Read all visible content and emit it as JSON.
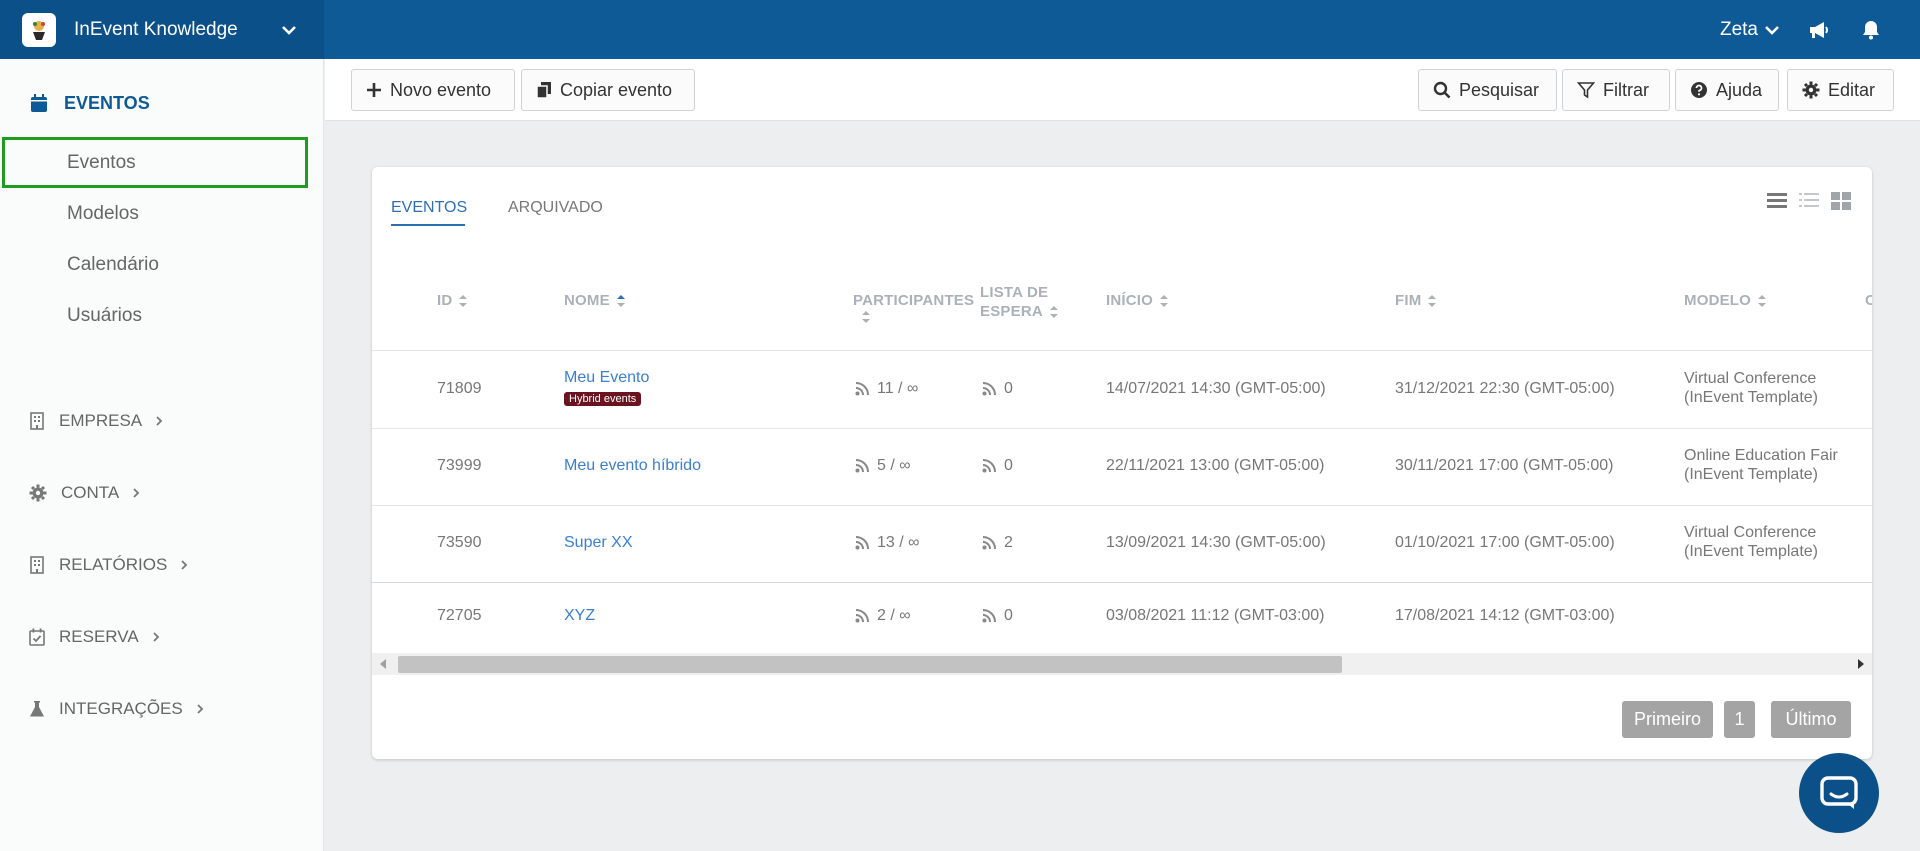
{
  "app": {
    "title": "InEvent Knowledge",
    "user": "Zeta"
  },
  "sidebar": {
    "section_title": "EVENTOS",
    "items": [
      {
        "label": "Eventos",
        "active": true
      },
      {
        "label": "Modelos"
      },
      {
        "label": "Calendário"
      },
      {
        "label": "Usuários"
      }
    ],
    "sections": [
      {
        "label": "EMPRESA",
        "icon": "building-icon"
      },
      {
        "label": "CONTA",
        "icon": "gear-icon"
      },
      {
        "label": "RELATÓRIOS",
        "icon": "building-icon"
      },
      {
        "label": "RESERVA",
        "icon": "calendar-check-icon"
      },
      {
        "label": "INTEGRAÇÕES",
        "icon": "flask-icon"
      }
    ]
  },
  "toolbar": {
    "new_event": "Novo evento",
    "copy_event": "Copiar evento",
    "search": "Pesquisar",
    "filter": "Filtrar",
    "help": "Ajuda",
    "edit": "Editar"
  },
  "tabs": [
    {
      "label": "EVENTOS",
      "active": true
    },
    {
      "label": "ARQUIVADO"
    }
  ],
  "table": {
    "columns": {
      "id": "ID",
      "name": "NOME",
      "participants": "PARTICIPANTES",
      "waitlist_1": "LISTA DE",
      "waitlist_2": "ESPERA",
      "start": "INÍCIO",
      "end": "FIM",
      "model": "MODELO",
      "cut": "C"
    },
    "rows": [
      {
        "id": "71809",
        "name": "Meu Evento",
        "badge": "Hybrid events",
        "participants": "11 / ∞",
        "waitlist": "0",
        "start": "14/07/2021 14:30 (GMT-05:00)",
        "end": "31/12/2021 22:30 (GMT-05:00)",
        "model_1": "Virtual Conference",
        "model_2": "(InEvent Template)"
      },
      {
        "id": "73999",
        "name": "Meu evento híbrido",
        "participants": "5 / ∞",
        "waitlist": "0",
        "start": "22/11/2021 13:00 (GMT-05:00)",
        "end": "30/11/2021 17:00 (GMT-05:00)",
        "model_1": "Online Education Fair",
        "model_2": "(InEvent Template)"
      },
      {
        "id": "73590",
        "name": "Super XX",
        "participants": "13 / ∞",
        "waitlist": "2",
        "start": "13/09/2021 14:30 (GMT-05:00)",
        "end": "01/10/2021 17:00 (GMT-05:00)",
        "model_1": "Virtual Conference",
        "model_2": "(InEvent Template)"
      },
      {
        "id": "72705",
        "name": "XYZ",
        "participants": "2 / ∞",
        "waitlist": "0",
        "start": "03/08/2021 11:12 (GMT-03:00)",
        "end": "17/08/2021 14:12 (GMT-03:00)",
        "model_1": "",
        "model_2": ""
      }
    ]
  },
  "pagination": {
    "first": "Primeiro",
    "page": "1",
    "last": "Último"
  },
  "colors": {
    "brand": "#0e5a96",
    "brand_dark": "#0b5088",
    "link": "#3a7fd0",
    "highlight": "#1f9c1f",
    "badge": "#6b1420"
  }
}
